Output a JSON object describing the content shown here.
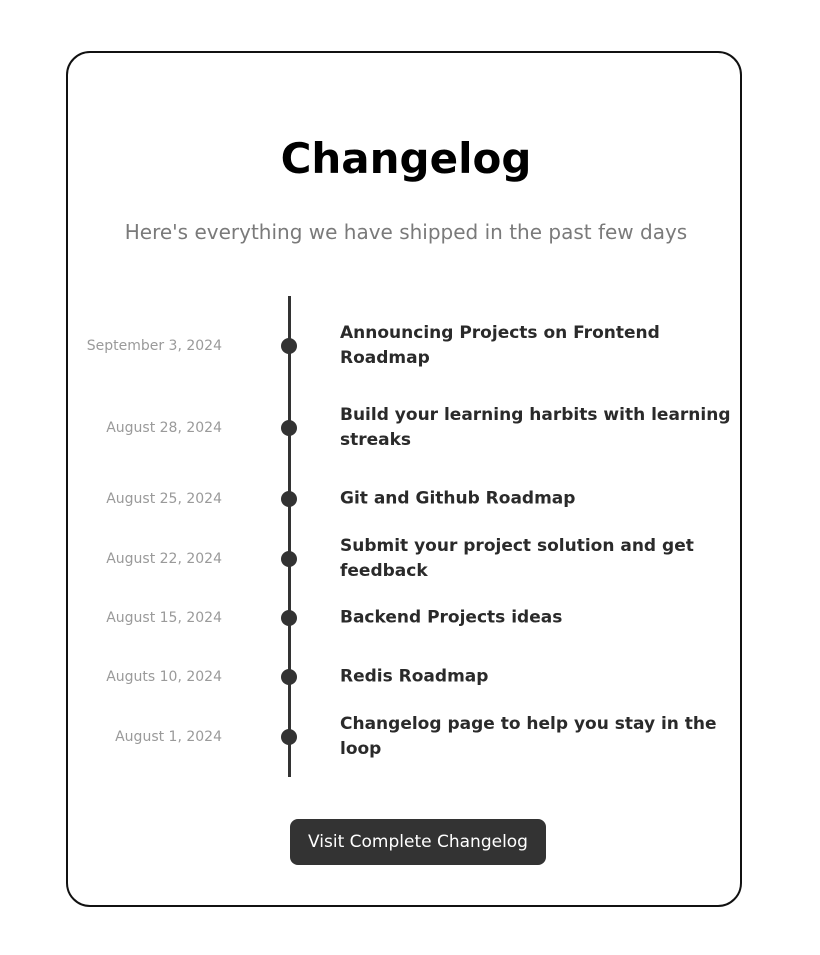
{
  "header": {
    "title": "Changelog",
    "subtitle": "Here's everything we have shipped in the past few days"
  },
  "entries": [
    {
      "date": "September 3, 2024",
      "title": "Announcing Projects on Frontend Roadmap"
    },
    {
      "date": "August 28, 2024",
      "title": "Build your learning harbits with learning streaks"
    },
    {
      "date": "August 25, 2024",
      "title": "Git and Github Roadmap"
    },
    {
      "date": "August 22, 2024",
      "title": "Submit your project solution and get feedback"
    },
    {
      "date": "August 15, 2024",
      "title": "Backend Projects ideas"
    },
    {
      "date": "Auguts 10, 2024",
      "title": "Redis Roadmap"
    },
    {
      "date": "August 1, 2024",
      "title": "Changelog page to help you stay in the loop"
    }
  ],
  "actions": {
    "visit_label": "Visit Complete Changelog"
  },
  "colors": {
    "accent": "#333333",
    "muted_text": "#9a9a9a",
    "subtitle_text": "#7a7a7a"
  }
}
